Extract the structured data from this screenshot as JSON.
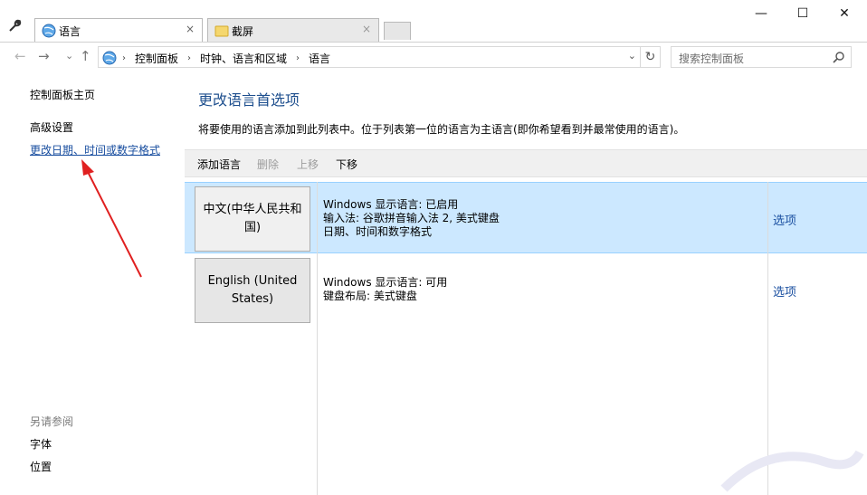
{
  "window": {
    "minimize_glyph": "—",
    "maximize_glyph": "☐",
    "close_glyph": "✕"
  },
  "tabs": [
    {
      "label": "语言",
      "close": "×",
      "icon": "globe-icon"
    },
    {
      "label": "截屏",
      "close": "×",
      "icon": "folder-icon"
    }
  ],
  "nav": {
    "back": "←",
    "forward": "→",
    "recent": "⌄",
    "up": "↑"
  },
  "address": {
    "breadcrumbs": [
      "控制面板",
      "时钟、语言和区域",
      "语言"
    ],
    "separator": "›",
    "dropdown": "⌄",
    "refresh": "↻"
  },
  "search": {
    "placeholder": "搜索控制面板"
  },
  "sidebar": {
    "home": "控制面板主页",
    "advanced": "高级设置",
    "change_format": "更改日期、时间或数字格式",
    "see_also_header": "另请参阅",
    "fonts": "字体",
    "location": "位置"
  },
  "main": {
    "title": "更改语言首选项",
    "description": "将要使用的语言添加到此列表中。位于列表第一位的语言为主语言(即你希望看到并最常使用的语言)。",
    "toolbar": {
      "add": "添加语言",
      "remove": "删除",
      "up": "上移",
      "down": "下移"
    },
    "languages": [
      {
        "name": "中文(中华人民共和国)",
        "lines": [
          "Windows 显示语言: 已启用",
          "输入法: 谷歌拼音输入法 2, 美式键盘",
          "日期、时间和数字格式"
        ],
        "option": "选项"
      },
      {
        "name": "English (United States)",
        "lines": [
          "Windows 显示语言: 可用",
          "键盘布局: 美式键盘"
        ],
        "option": "选项"
      }
    ]
  },
  "colors": {
    "accent_link": "#1a4fa0",
    "selection": "#cce8ff",
    "annotation_arrow": "#e02020"
  }
}
